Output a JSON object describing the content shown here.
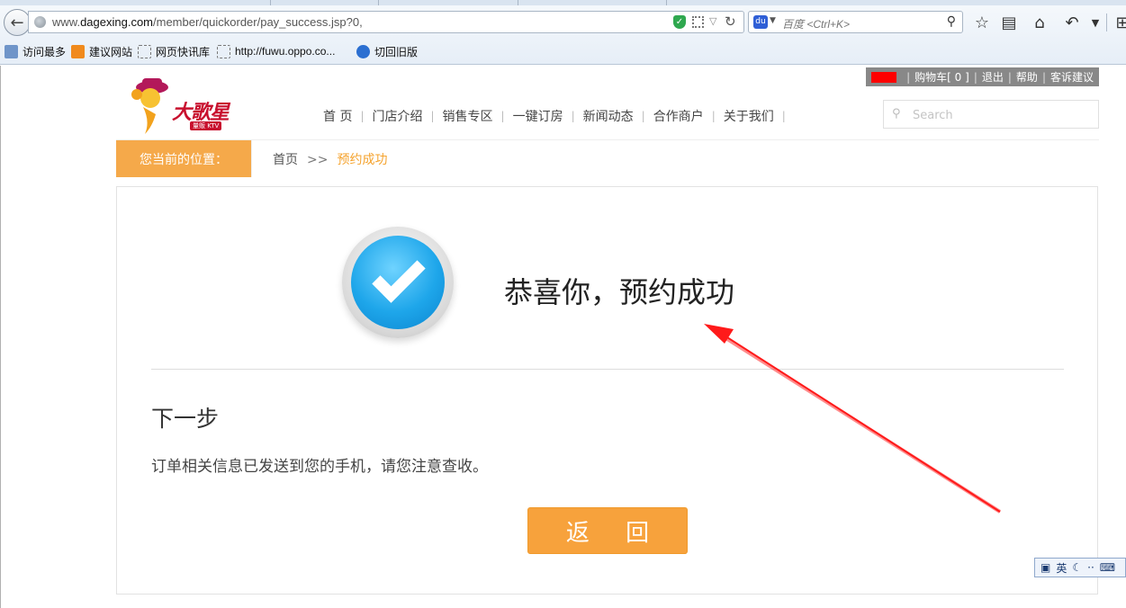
{
  "browser": {
    "url_prefix": "www.",
    "url_domain": "dagexing.com",
    "url_path": "/member/quickorder/pay_success.jsp?0,",
    "search_placeholder": "百度 <Ctrl+K>",
    "bookmarks": [
      "访问最多",
      "建议网站",
      "网页快讯库",
      "http://fuwu.oppo.co...",
      "切回旧版"
    ]
  },
  "topbar": {
    "cart": "购物车[ 0 ]",
    "logout": "退出",
    "help": "帮助",
    "feedback": "客诉建议"
  },
  "logo": {
    "text": "大歌星",
    "sub": "量贩 KTV"
  },
  "nav": {
    "items": [
      "首 页",
      "门店介绍",
      "销售专区",
      "一键订房",
      "新闻动态",
      "合作商户",
      "关于我们"
    ]
  },
  "site_search": {
    "placeholder": "Search"
  },
  "breadcrumb": {
    "label": "您当前的位置：",
    "home": "首页",
    "separator": ">>",
    "current": "预约成功"
  },
  "result": {
    "title": "恭喜你，预约成功",
    "next_title": "下一步",
    "next_text": "订单相关信息已发送到您的手机，请您注意查收。",
    "return_button": "返 回"
  },
  "ime": {
    "lang": "英"
  },
  "colors": {
    "accent_orange": "#f5a94a",
    "crumb_current": "#f5a32e",
    "annotation_arrow": "#ff1a1a",
    "check_blue": "#1ea6ea"
  }
}
